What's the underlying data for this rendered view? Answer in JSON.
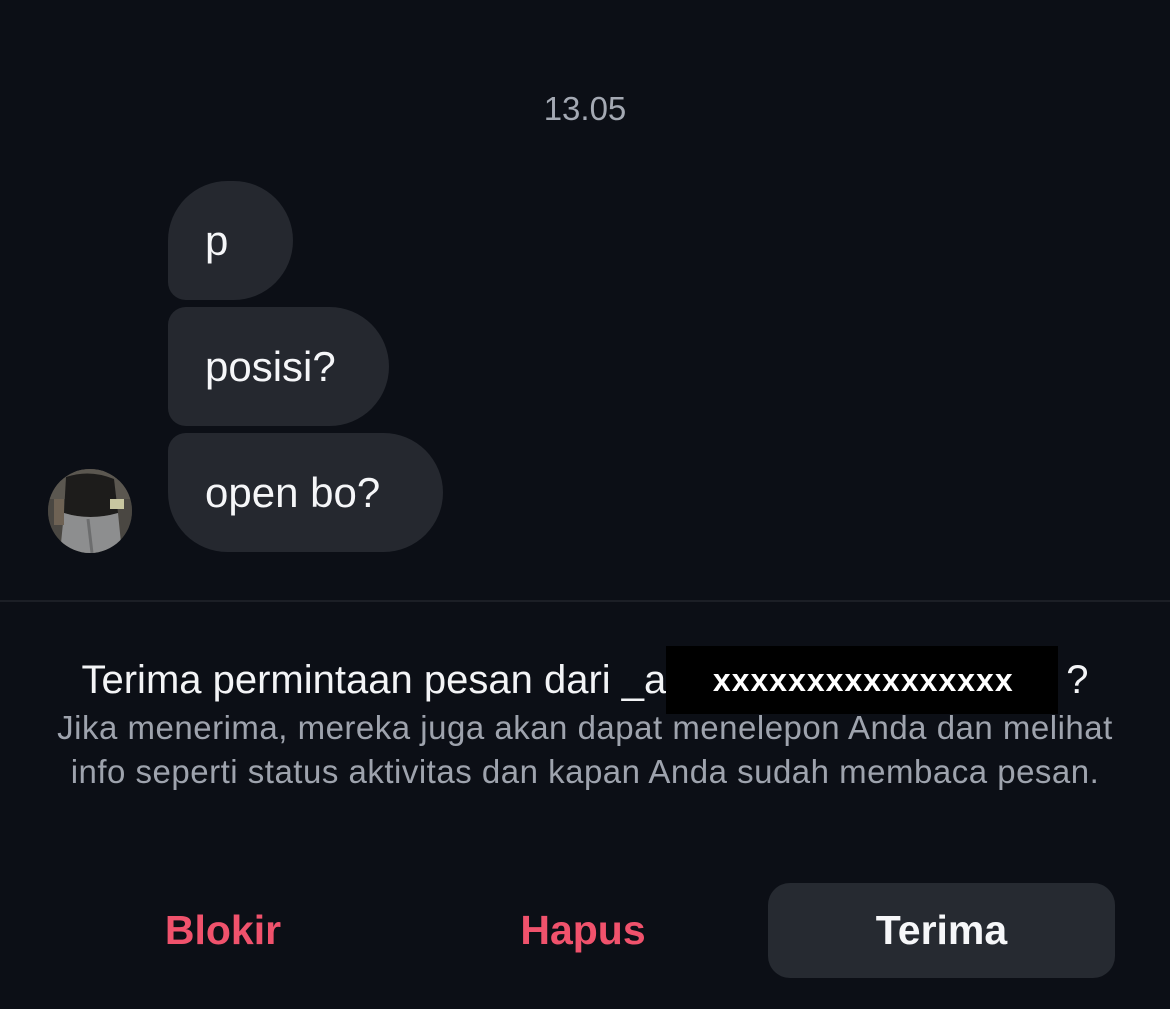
{
  "chat": {
    "timestamp": "13.05",
    "messages": [
      {
        "text": "p"
      },
      {
        "text": "posisi?"
      },
      {
        "text": "open bo?"
      }
    ]
  },
  "request": {
    "title_prefix": "Terima permintaan pesan dari _a",
    "username_redacted": "xxxxxxxxxxxxxxxx",
    "title_suffix": "?",
    "description": "Jika menerima, mereka juga akan dapat menelepon Anda dan melihat info seperti status aktivitas dan kapan Anda sudah membaca pesan."
  },
  "actions": {
    "block_label": "Blokir",
    "delete_label": "Hapus",
    "accept_label": "Terima"
  },
  "colors": {
    "background": "#0c0f16",
    "bubble": "#25282f",
    "danger": "#f0526c",
    "accept_button": "#262a31"
  }
}
